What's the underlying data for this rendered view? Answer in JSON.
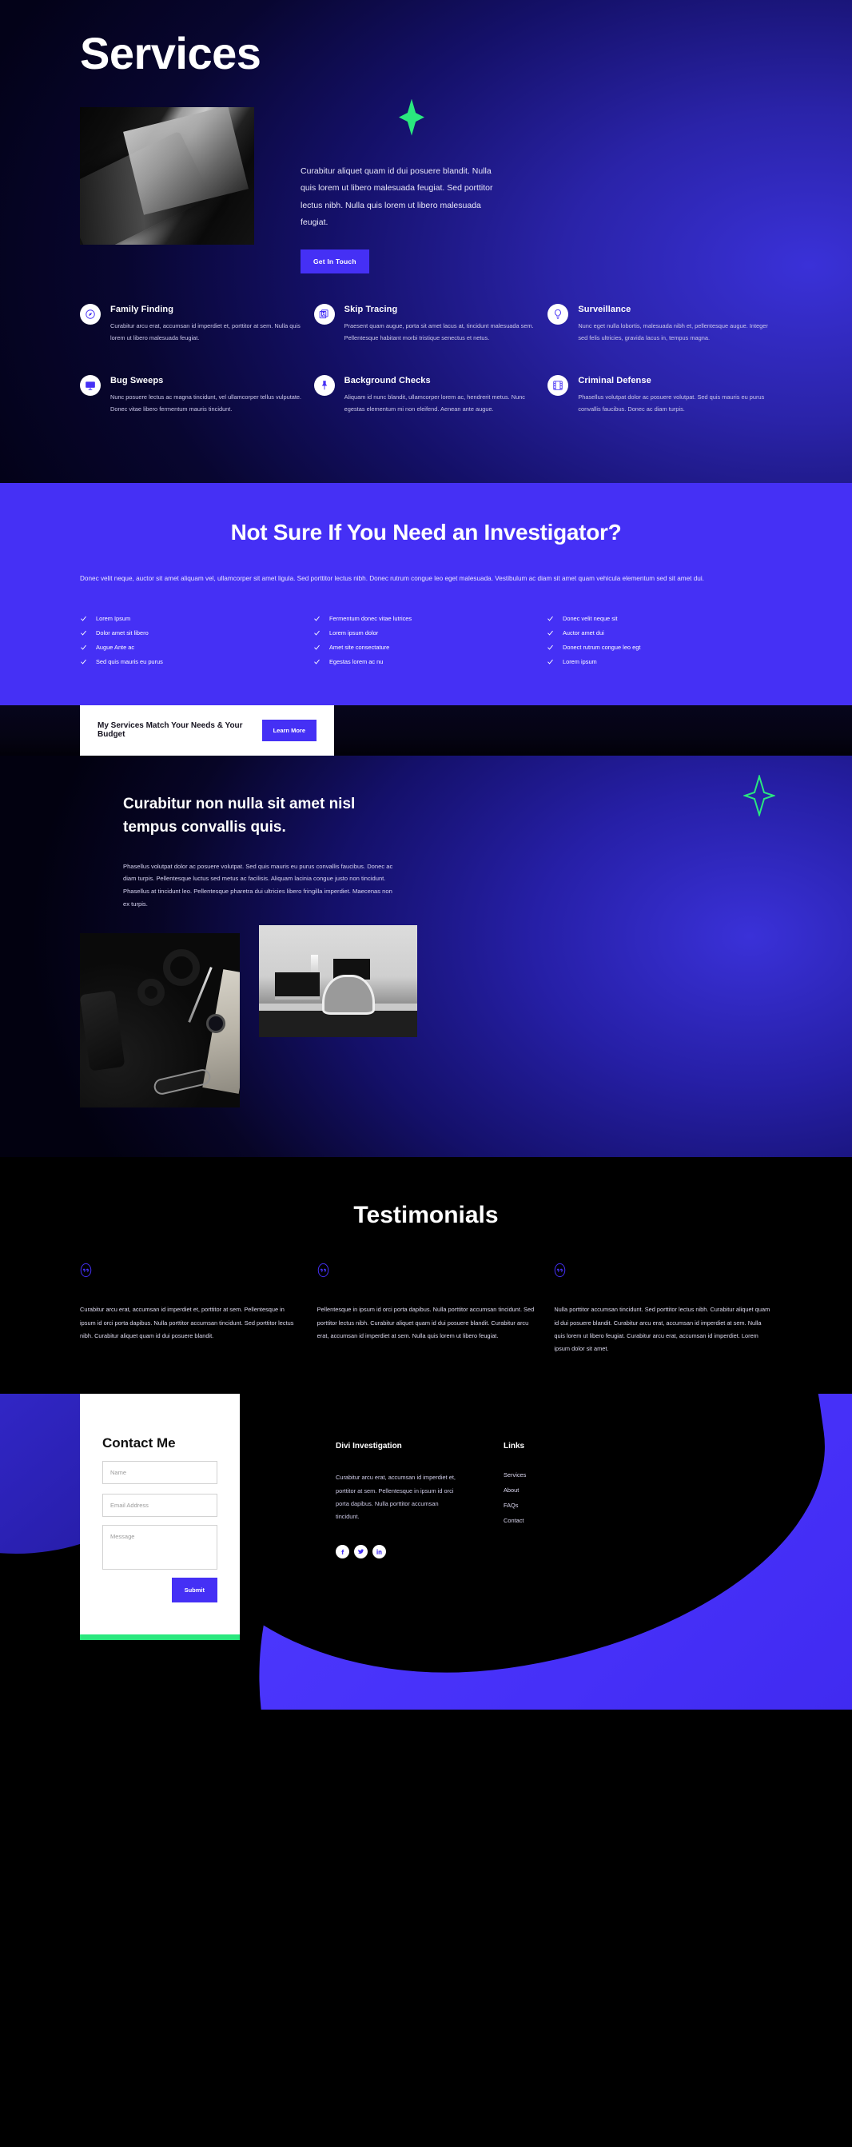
{
  "hero": {
    "title": "Services",
    "paragraph": "Curabitur aliquet quam id dui posuere blandit. Nulla quis lorem ut libero malesuada feugiat. Sed porttitor lectus nibh. Nulla quis lorem ut libero malesuada feugiat.",
    "cta_label": "Get In Touch",
    "photo_alt": "camera-and-lens-photo",
    "accent_color": "#2ae87e"
  },
  "services": [
    {
      "icon": "compass-icon",
      "title": "Family Finding",
      "text": "Curabitur arcu erat, accumsan id imperdiet et, porttitor at sem. Nulla quis lorem ut libero malesuada feugiat."
    },
    {
      "icon": "photos-stack-icon",
      "title": "Skip Tracing",
      "text": "Praesent quam augue, porta sit amet lacus at, tincidunt malesuada sem. Pellentesque habitant morbi tristique senectus et netus."
    },
    {
      "icon": "lightbulb-icon",
      "title": "Surveillance",
      "text": "Nunc eget nulla lobortis, malesuada nibh et, pellentesque augue. Integer sed felis ultricies, gravida lacus in, tempus magna."
    },
    {
      "icon": "monitor-icon",
      "title": "Bug Sweeps",
      "text": "Nunc posuere lectus ac magna tincidunt, vel ullamcorper tellus vulputate. Donec vitae libero fermentum mauris tincidunt."
    },
    {
      "icon": "pushpin-icon",
      "title": "Background Checks",
      "text": "Aliquam id nunc blandit, ullamcorper lorem ac, hendrerit metus. Nunc egestas elementum mi non eleifend. Aenean ante augue."
    },
    {
      "icon": "film-strip-icon",
      "title": "Criminal Defense",
      "text": "Phasellus volutpat dolor ac posuere volutpat. Sed quis mauris eu purus convallis faucibus. Donec ac diam turpis."
    }
  ],
  "not_sure": {
    "title": "Not Sure If You Need an Investigator?",
    "paragraph": "Donec velit neque, auctor sit amet aliquam vel, ullamcorper sit amet ligula. Sed porttitor lectus nibh. Donec rutrum congue leo eget malesuada. Vestibulum ac diam sit amet quam vehicula elementum sed sit amet dui.",
    "background_color": "#4530f5",
    "checklist": [
      "Lorem Ipsum",
      "Fermentum donec vitae lutrices",
      "Donec velit neque sit",
      "Dolor amet sit libero",
      "Lorem ipsum dolor",
      "Auctor amet dui",
      "Augue Ante ac",
      "Amet site consectature",
      "Donect rutrum congue leo egt",
      "Sed quis mauris eu purus",
      "Egestas lorem ac nu",
      "Lorem ipsum"
    ]
  },
  "cta_bar": {
    "text": "My Services Match Your Needs & Your Budget",
    "button_label": "Learn More"
  },
  "feature": {
    "title": "Curabitur non nulla sit amet nisl tempus convallis quis.",
    "paragraph": "Phasellus volutpat dolor ac posuere volutpat. Sed quis mauris eu purus convallis faucibus. Donec ac diam turpis. Pellentesque luctus sed metus ac facilisis. Aliquam lacinia congue justo non tincidunt. Phasellus at tincidunt leo. Pellentesque pharetra dui ultricies libero fringilla imperdiet. Maecenas non ex turpis.",
    "photo_left_alt": "dark-desk-flatlay-photo",
    "photo_right_alt": "office-desk-laptop-photo"
  },
  "testimonials": {
    "title": "Testimonials",
    "items": [
      "Curabitur arcu erat, accumsan id imperdiet et, porttitor at sem. Pellentesque in ipsum id orci porta dapibus. Nulla porttitor accumsan tincidunt. Sed porttitor lectus nibh. Curabitur aliquet quam id dui posuere blandit.",
      "Pellentesque in ipsum id orci porta dapibus. Nulla porttitor accumsan tincidunt. Sed porttitor lectus nibh. Curabitur aliquet quam id dui posuere blandit. Curabitur arcu erat, accumsan id imperdiet at sem. Nulla quis lorem ut libero feugiat.",
      "Nulla porttitor accumsan tincidunt. Sed porttitor lectus nibh. Curabitur aliquet quam id dui posuere blandit. Curabitur arcu erat, accumsan id imperdiet at sem. Nulla quis lorem ut libero feugiat. Curabitur arcu erat, accumsan id imperdiet. Lorem ipsum dolor sit amet."
    ]
  },
  "contact": {
    "title": "Contact Me",
    "name_placeholder": "Name",
    "email_placeholder": "Email Address",
    "message_placeholder": "Message",
    "name_value": "",
    "email_value": "",
    "message_value": "",
    "submit_label": "Submit"
  },
  "footer": {
    "brand_title": "Divi Investigation",
    "brand_text": "Curabitur arcu erat, accumsan id imperdiet et, porttitor at sem. Pellentesque in ipsum id orci porta dapibus. Nulla porttitor accumsan tincidunt.",
    "links_title": "Links",
    "links": [
      "Services",
      "About",
      "FAQs",
      "Contact"
    ],
    "socials": [
      "facebook-icon",
      "twitter-icon",
      "linkedin-icon"
    ],
    "accent_strip_color": "#2ae87e"
  }
}
